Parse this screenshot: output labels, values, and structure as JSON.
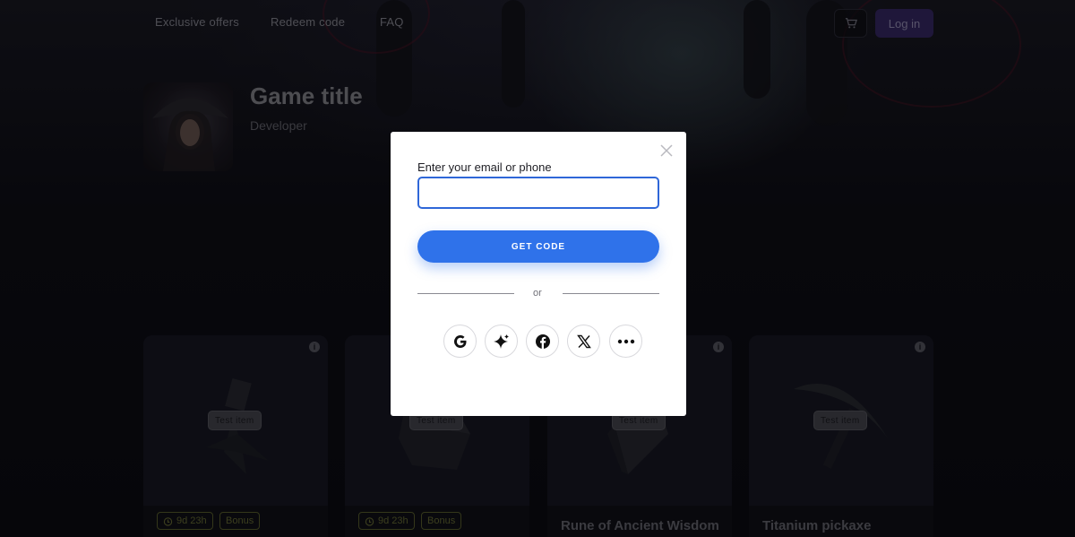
{
  "nav": {
    "links": [
      "Exclusive offers",
      "Redeem code",
      "FAQ"
    ],
    "login_label": "Log in"
  },
  "game": {
    "title": "Game title",
    "developer": "Developer"
  },
  "cards": [
    {
      "tag": "Test item",
      "timer": "9d 23h",
      "bonus": "Bonus",
      "name": ""
    },
    {
      "tag": "Test item",
      "timer": "9d 23h",
      "bonus": "Bonus",
      "name": ""
    },
    {
      "tag": "Test item",
      "timer": "",
      "bonus": "",
      "name": "Rune of Ancient Wisdom"
    },
    {
      "tag": "Test item",
      "timer": "",
      "bonus": "",
      "name": "Titanium pickaxe"
    }
  ],
  "login_modal": {
    "field_label": "Enter your email or phone",
    "field_value": "",
    "field_placeholder": "",
    "submit_label": "GET CODE",
    "divider_text": "or",
    "social_providers": [
      "google-icon",
      "sparkle-icon",
      "facebook-icon",
      "x-icon",
      "more-icon"
    ]
  },
  "colors": {
    "primary_button": "#2f72ea",
    "input_border": "#2f67d8",
    "login_button": "#3a2a6b",
    "chip_border": "#5f6431"
  }
}
